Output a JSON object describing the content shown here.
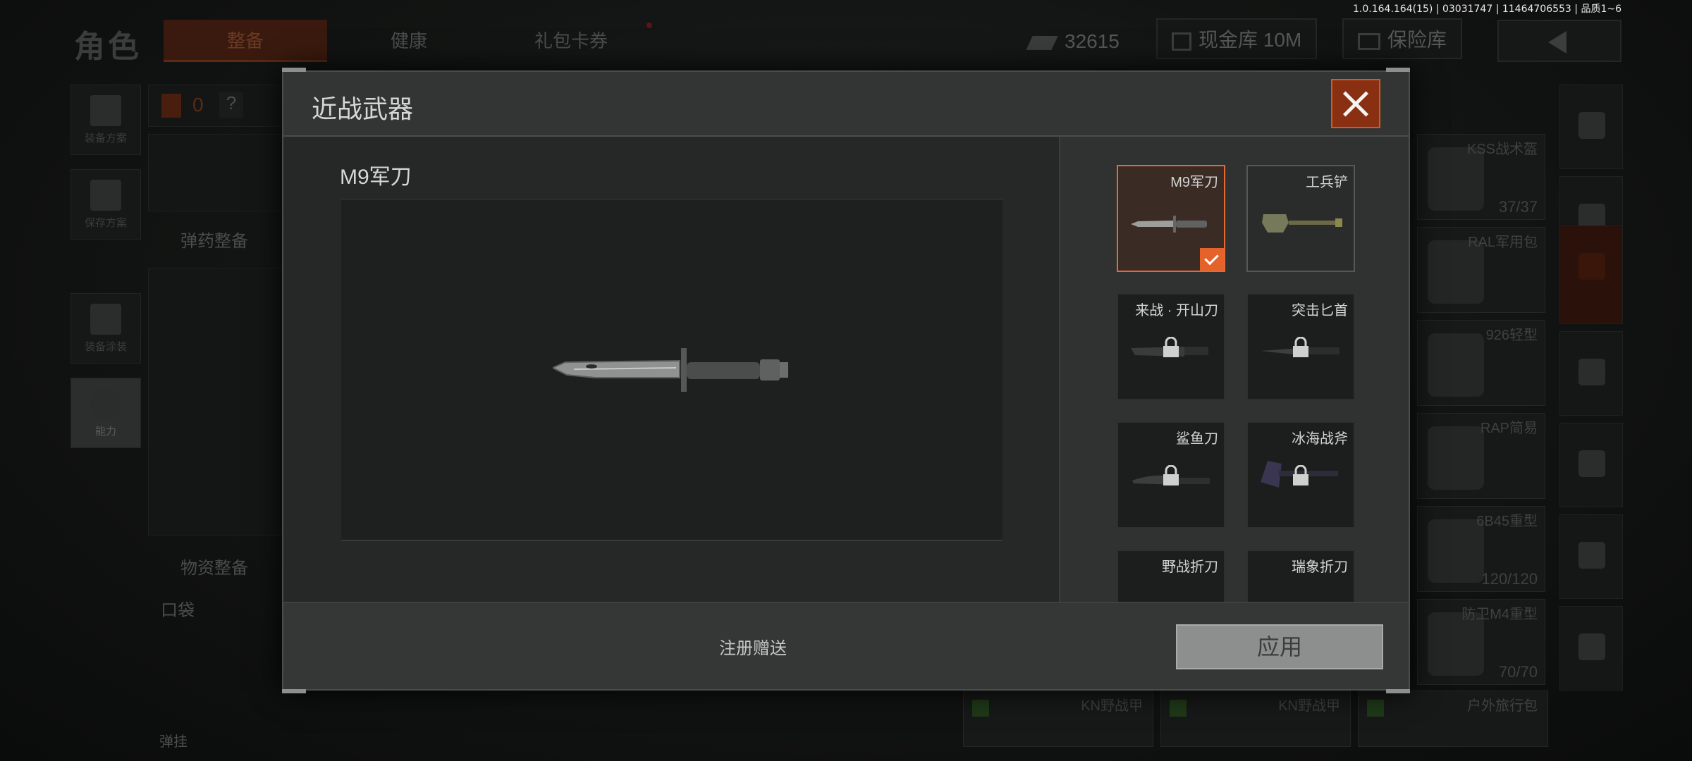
{
  "build_info": "1.0.164.164(15) | 03031747 | 11464706553 | 品质1~6",
  "background": {
    "page_title": "角色",
    "tabs": [
      {
        "label": "整备",
        "active": true
      },
      {
        "label": "健康",
        "active": false
      },
      {
        "label": "礼包卡券",
        "active": false
      }
    ],
    "money": "32615",
    "cash_vault": "现金库 10M",
    "safe_vault": "保险库",
    "side_buttons": [
      "装备方案",
      "保存方案",
      "装备涂装",
      "能力"
    ],
    "armor_count": "0",
    "help_mark": "?",
    "ammo_label": "弹药整备",
    "supply_label": "物资整备",
    "pocket_label": "口袋",
    "extra_label": "弹挂",
    "right_items": [
      {
        "name": "KSS战术盔",
        "count": "37/37"
      },
      {
        "name": "RAL军用包",
        "count": ""
      },
      {
        "name": "926轻型",
        "count": ""
      },
      {
        "name": "RAP简易",
        "count": ""
      },
      {
        "name": "6B45重型",
        "count": "120/120"
      },
      {
        "name": "防卫M4重型",
        "count": "70/70"
      }
    ],
    "bottom_items": [
      "KN野战甲",
      "KN野战甲",
      "户外旅行包"
    ]
  },
  "modal": {
    "title": "近战武器",
    "selected_weapon": "M9军刀",
    "footer_note": "注册赠送",
    "apply_label": "应用",
    "accent_color": "#e5622b",
    "weapons": [
      {
        "name": "M9军刀",
        "state": "selected"
      },
      {
        "name": "工兵铲",
        "state": "unlocked"
      },
      {
        "name": "来战 · 开山刀",
        "state": "locked"
      },
      {
        "name": "突击匕首",
        "state": "locked"
      },
      {
        "name": "鲨鱼刀",
        "state": "locked"
      },
      {
        "name": "冰海战斧",
        "state": "locked"
      },
      {
        "name": "野战折刀",
        "state": "locked"
      },
      {
        "name": "瑞象折刀",
        "state": "locked"
      }
    ]
  }
}
